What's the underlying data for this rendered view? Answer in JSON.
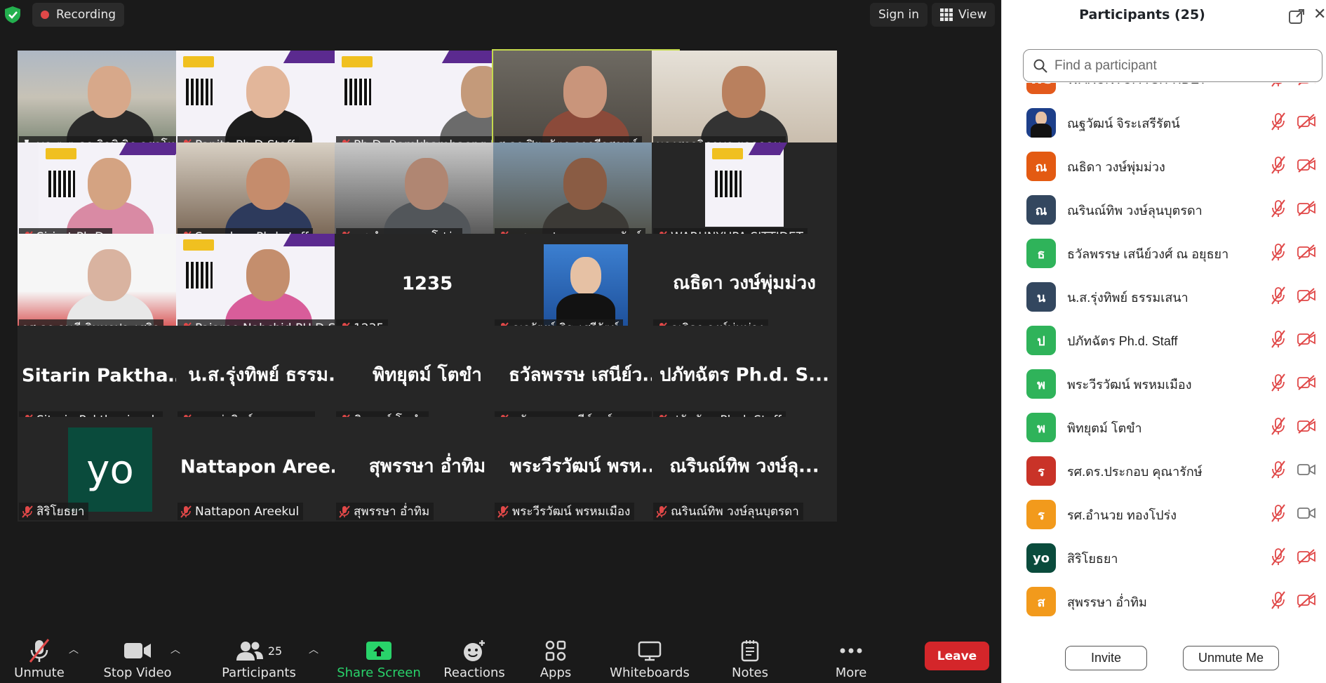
{
  "topbar": {
    "recording_label": "Recording",
    "signin_label": "Sign in",
    "view_label": "View"
  },
  "tiles": [
    {
      "name": "พล.ต.ต.ดร.กิจพิณิฐ อุสาโห",
      "type": "video",
      "pinned": true,
      "muted": false
    },
    {
      "name": "Panita Ph.D.Staff",
      "type": "video",
      "muted": true
    },
    {
      "name": "Ph.D. Ramkhamhaeng Un...",
      "type": "video",
      "muted": true
    },
    {
      "name": "ศ.ดร.ปิยะฉัตร จารุธีรศานต์",
      "type": "video",
      "muted": false,
      "active": true
    },
    {
      "name": "นางสาววิภาพร ยอดอุดม",
      "type": "video",
      "muted": false
    },
    {
      "name": "Sirirat Ph.D.",
      "type": "video",
      "muted": true
    },
    {
      "name": "Suraphon Phd.staff",
      "type": "video",
      "muted": true
    },
    {
      "name": "รศ.อำนวย ทองโปร่ง",
      "type": "video",
      "muted": true
    },
    {
      "name": "รศ.ดร.ประกอบ คุณารักษ์",
      "type": "video",
      "muted": true
    },
    {
      "name": "WARUNYUPA SITTIDET",
      "type": "video",
      "muted": true
    },
    {
      "name": "รศ.ดร.ดุษฎี อินทรประเสริฐ",
      "type": "video",
      "muted": false
    },
    {
      "name": "Pajaree Nabchid PH.D Staff",
      "type": "video",
      "muted": true
    },
    {
      "name": "1235",
      "type": "name",
      "big": "1235",
      "muted": true
    },
    {
      "name": "ณฐวัฒน์ จิระเสรีรัตน์",
      "type": "photo",
      "muted": true
    },
    {
      "name": "ณธิดา วงษ์พุ่มม่วง",
      "type": "name",
      "big": "ณธิดา วงษ์พุ่มม่วง",
      "muted": true
    },
    {
      "name": "Sitarin Pakthaninsak",
      "type": "name",
      "big": "Sitarin  Pakthani...",
      "muted": true
    },
    {
      "name": "น.ส.รุ่งทิพย์ ธรรมเสนา",
      "type": "name",
      "big": "น.ส.รุ่งทิพย์ ธรรม...",
      "muted": true
    },
    {
      "name": "พิทยุตม์ โตขำ",
      "type": "name",
      "big": "พิทยุตม์ โตขำ",
      "muted": true
    },
    {
      "name": "ธวัลพรรษ เสนีย์วงศ์ ณ อยุธยา",
      "type": "name",
      "big": "ธวัลพรรษ เสนีย์ว...",
      "muted": true
    },
    {
      "name": "ปภัทฉัตร Ph.d. Staff",
      "type": "name",
      "big": "ปภัทฉัตร Ph.d. S...",
      "muted": true
    },
    {
      "name": "สิริโยธยา",
      "type": "avatar",
      "big": "yo",
      "muted": true
    },
    {
      "name": "Nattapon Areekul",
      "type": "name",
      "big": "Nattapon Areekul",
      "muted": true
    },
    {
      "name": "สุพรรษา อ่ำทิม",
      "type": "name",
      "big": "สุพรรษา อ่ำทิม",
      "muted": true
    },
    {
      "name": "พระวีรวัฒน์ พรหมเมือง",
      "type": "name",
      "big": "พระวีรวัฒน์ พรห...",
      "muted": true
    },
    {
      "name": "ณรินณ์ทิพ วงษ์ลุนบุตรดา",
      "type": "name",
      "big": "ณรินณ์ทิพ วงษ์ลุ...",
      "muted": true
    }
  ],
  "toolbar": {
    "unmute": "Unmute",
    "stop_video": "Stop Video",
    "participants": "Participants",
    "participants_count": "25",
    "share_screen": "Share Screen",
    "reactions": "Reactions",
    "apps": "Apps",
    "whiteboards": "Whiteboards",
    "notes": "Notes",
    "more": "More",
    "leave": "Leave"
  },
  "panel": {
    "title": "Participants (25)",
    "search_placeholder": "Find a participant",
    "participants": [
      {
        "initial": "WS",
        "name": "WARUNYUPA SITTIDET",
        "color": "#e35a1c",
        "cam_off": true
      },
      {
        "initial": "",
        "name": "ณฐวัฒน์ จิระเสรีรัตน์",
        "color": "#1d3f8a",
        "photo": true,
        "cam_off": true
      },
      {
        "initial": "ณ",
        "name": "ณธิดา วงษ์พุ่มม่วง",
        "color": "#e35a12",
        "cam_off": true
      },
      {
        "initial": "ณ",
        "name": "ณรินณ์ทิพ วงษ์ลุนบุตรดา",
        "color": "#33475f",
        "cam_off": true
      },
      {
        "initial": "ธ",
        "name": "ธวัลพรรษ เสนีย์วงศ์ ณ อยุธยา",
        "color": "#2fb35a",
        "cam_off": true
      },
      {
        "initial": "น",
        "name": "น.ส.รุ่งทิพย์ ธรรมเสนา",
        "color": "#33475f",
        "cam_off": true
      },
      {
        "initial": "ป",
        "name": "ปภัทฉัตร Ph.d. Staff",
        "color": "#2fb35a",
        "cam_off": true
      },
      {
        "initial": "พ",
        "name": "พระวีรวัฒน์ พรหมเมือง",
        "color": "#2fb35a",
        "cam_off": true
      },
      {
        "initial": "พ",
        "name": "พิทยุตม์ โตขำ",
        "color": "#2fb35a",
        "cam_off": true
      },
      {
        "initial": "ร",
        "name": "รศ.ดร.ประกอบ คุณารักษ์",
        "color": "#c93328",
        "cam_off": false
      },
      {
        "initial": "ร",
        "name": "รศ.อำนวย ทองโปร่ง",
        "color": "#f29a1c",
        "cam_off": false
      },
      {
        "initial": "yo",
        "name": "สิริโยธยา",
        "color": "#0a4b3c",
        "cam_off": true
      },
      {
        "initial": "ส",
        "name": "สุพรรษา อ่ำทิม",
        "color": "#f29a1c",
        "cam_off": true
      }
    ],
    "invite_label": "Invite",
    "unmute_me_label": "Unmute Me"
  },
  "colors": {
    "accent_green": "#29d36a",
    "leave_red": "#d4262a",
    "active_speaker": "#c4d94e",
    "muted_red": "#e04848"
  }
}
